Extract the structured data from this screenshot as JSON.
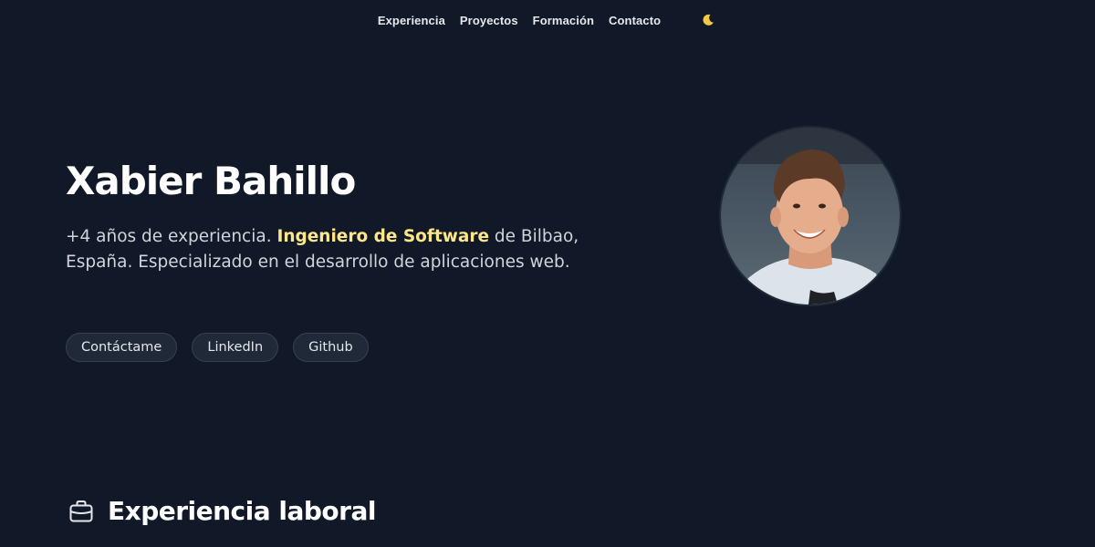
{
  "nav": {
    "items": [
      {
        "label": "Experiencia"
      },
      {
        "label": "Proyectos"
      },
      {
        "label": "Formación"
      },
      {
        "label": "Contacto"
      }
    ],
    "theme_icon": "moon-icon"
  },
  "hero": {
    "name": "Xabier Bahillo",
    "desc_part1": "+4 años de experiencia. ",
    "desc_highlight": "Ingeniero de Software",
    "desc_part2": " de Bilbao, España. Especializado en el desarrollo de aplicaciones web.",
    "buttons": [
      {
        "label": "Contáctame"
      },
      {
        "label": "LinkedIn"
      },
      {
        "label": "Github"
      }
    ],
    "avatar_icon": "profile-photo"
  },
  "section": {
    "title": "Experiencia laboral",
    "icon": "briefcase-icon"
  },
  "colors": {
    "background": "#111827",
    "highlight": "#fde68a",
    "moon": "#f5c842"
  }
}
